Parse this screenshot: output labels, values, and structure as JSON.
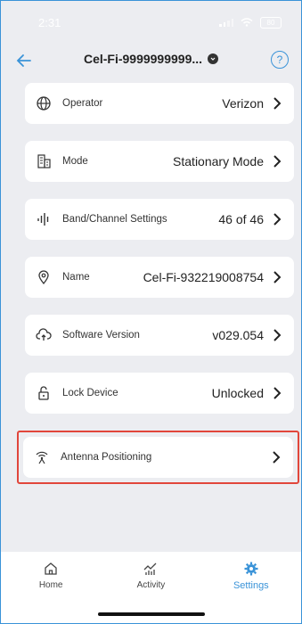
{
  "status": {
    "time": "2:31",
    "battery": "80"
  },
  "header": {
    "title": "Cel-Fi-9999999999..."
  },
  "settings": [
    {
      "label": "Operator",
      "value": "Verizon",
      "icon": "globe-icon"
    },
    {
      "label": "Mode",
      "value": "Stationary Mode",
      "icon": "building-icon"
    },
    {
      "label": "Band/Channel Settings",
      "value": "46 of 46",
      "icon": "bars-icon"
    },
    {
      "label": "Name",
      "value": "Cel-Fi-932219008754",
      "icon": "location-pin-icon"
    },
    {
      "label": "Software Version",
      "value": "v029.054",
      "icon": "cloud-upload-icon"
    },
    {
      "label": "Lock Device",
      "value": "Unlocked",
      "icon": "lock-icon"
    },
    {
      "label": "Antenna Positioning",
      "value": "",
      "icon": "antenna-icon"
    }
  ],
  "tabs": [
    {
      "label": "Home",
      "icon": "home-icon"
    },
    {
      "label": "Activity",
      "icon": "activity-icon"
    },
    {
      "label": "Settings",
      "icon": "gear-icon",
      "active": true
    }
  ],
  "colors": {
    "accent": "#3a93d8",
    "highlight": "#e1463b",
    "background": "#ecedf1"
  }
}
